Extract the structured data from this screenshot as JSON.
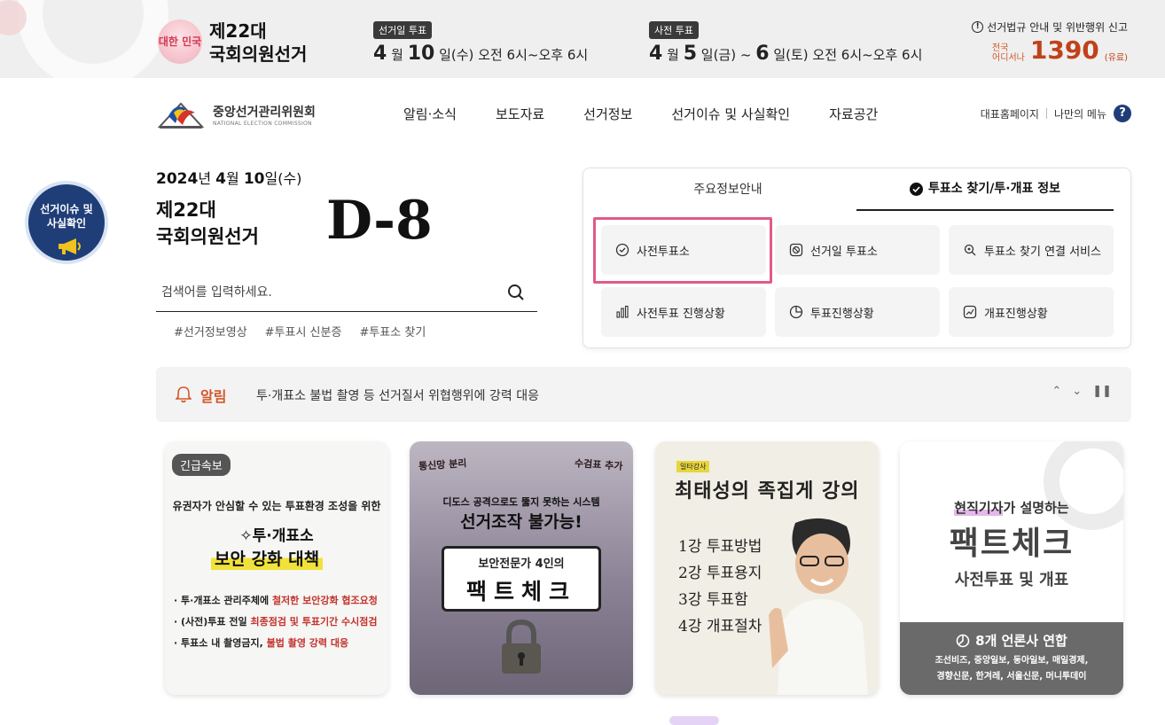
{
  "banner": {
    "mascot_text": "대한 민국",
    "election_title_line1": "제22대",
    "election_title_line2": "국회의원선거",
    "election_day": {
      "badge": "선거일 투표",
      "month": "4",
      "month_unit": "월",
      "day": "10",
      "day_unit": "일(수)",
      "time": "오전 6시~오후 6시"
    },
    "early_vote": {
      "badge": "사전 투표",
      "month": "4",
      "month_unit": "월",
      "day_start": "5",
      "day_start_unit": "일(금) ~",
      "day_end": "6",
      "day_end_unit": "일(토)",
      "time": "오전 6시~오후 6시"
    },
    "report": {
      "title": "선거법규 안내 및 위반행위 신고",
      "small_line1": "전국",
      "small_line2": "어디서나",
      "number": "1390",
      "paid": "(유료)"
    }
  },
  "header": {
    "logo_title": "중앙선거관리위원회",
    "logo_subtitle": "NATIONAL ELECTION COMMISSION",
    "nav": [
      "알림·소식",
      "보도자료",
      "선거정보",
      "선거이슈 및 사실확인",
      "자료공간"
    ],
    "util_home": "대표홈페이지",
    "util_menu": "나만의 메뉴",
    "util_help": "?"
  },
  "float_badge": {
    "line1": "선거이슈 및",
    "line2": "사실확인"
  },
  "dday": {
    "date_year": "2024",
    "date_year_unit": "년",
    "date_month": "4",
    "date_month_unit": "월",
    "date_day": "10",
    "date_day_unit": "일(수)",
    "title_line1": "제22대",
    "title_line2": "국회의원선거",
    "count": "D-8"
  },
  "search": {
    "placeholder": "검색어를 입력하세요."
  },
  "tags": [
    "#선거정보영상",
    "#투표시 신분증",
    "#투표소 찾기"
  ],
  "panel": {
    "tabs": [
      "주요정보안내",
      "투표소 찾기/투·개표 정보"
    ],
    "buttons": [
      "사전투표소",
      "선거일 투표소",
      "투표소 찾기 연결 서비스",
      "사전투표 진행상황",
      "투표진행상황",
      "개표진행상황"
    ]
  },
  "alert": {
    "label": "알림",
    "message": "투·개표소 불법 촬영 등 선거질서 위협행위에 강력 대응"
  },
  "cards": {
    "c1": {
      "badge": "긴급속보",
      "line1": "유권자가 안심할 수 있는 투표환경 조성을 위한",
      "line2": "✧투·개표소",
      "line3": "보안 강화 대책",
      "b1a": "투·개표소 관리주체에 ",
      "b1b": "철저한 보안강화 협조요청",
      "b2a": "(사전)투표 전일 ",
      "b2b": "최종점검 및 투표기간 수시점검",
      "b3a": "투표소 내 촬영금지, ",
      "b3b": "불법 촬영 강력 대응"
    },
    "c2": {
      "top_left": "통신망 분리",
      "top_right": "수검표 추가",
      "sub1": "디도스 공격으로도 뚫지 못하는 시스템",
      "sub2": "선거조작 불가능!",
      "bubble1": "보안전문가 4인의",
      "bubble2": "팩트체크"
    },
    "c3": {
      "tag": "일타강사",
      "title": "최태성의 족집게 강의",
      "lessons": [
        "1강 투표방법",
        "2강 투표용지",
        "3강 투표함",
        "4강 개표절차"
      ]
    },
    "c4": {
      "h1a": "현직기자",
      "h1b": "가 설명하는",
      "h2": "팩트체크",
      "h3": "사전투표 및 개표",
      "g1": "8개 언론사 연합",
      "g2a": "조선비즈, 중앙일보, 동아일보, 매일경제,",
      "g2b": "경향신문, 한겨레, 서울신문, 머니투데이"
    }
  },
  "colors": {
    "accent_navy": "#1f3e78",
    "alert_orange": "#d4572a",
    "highlight_pink": "#e05a8a"
  }
}
